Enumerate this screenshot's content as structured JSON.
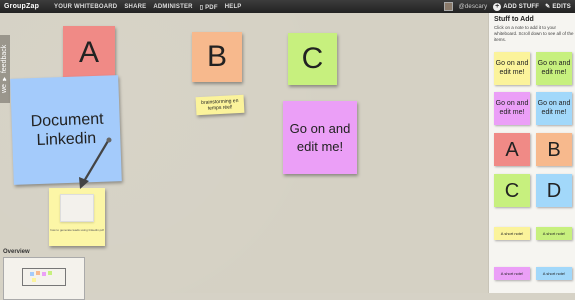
{
  "topbar": {
    "brand": "GroupZap",
    "nav": [
      "YOUR WHITEBOARD",
      "SHARE",
      "ADMINISTER",
      "PDF",
      "HELP"
    ],
    "user": "@descary",
    "add_stuff": "ADD STUFF",
    "edits": "EDITS"
  },
  "board": {
    "feedback": "we ♥ feedback",
    "notes": {
      "a": "A",
      "b": "B",
      "c": "C",
      "document": "Document Linkedin",
      "brainstorm": "brainstorming en temps réel!",
      "go_on": "Go on and edit me!",
      "image_caption": "how to generate leads using linkedin.pdf"
    },
    "overview_label": "Overview"
  },
  "panel": {
    "title": "Stuff to Add",
    "description": "Click on a note to add it to your whiteboard. Scroll down to see all of the items.",
    "go_on": "Go on and edit me!",
    "letters": [
      "A",
      "B",
      "C",
      "D"
    ],
    "short_note": "A short note!"
  },
  "colors": {
    "red": "#f08a86",
    "orange": "#f7b98d",
    "green": "#c7f07e",
    "blue": "#a4cbfb",
    "yellow": "#fbf39b",
    "pink": "#eb9ff7",
    "cyan": "#a2d8fa"
  }
}
